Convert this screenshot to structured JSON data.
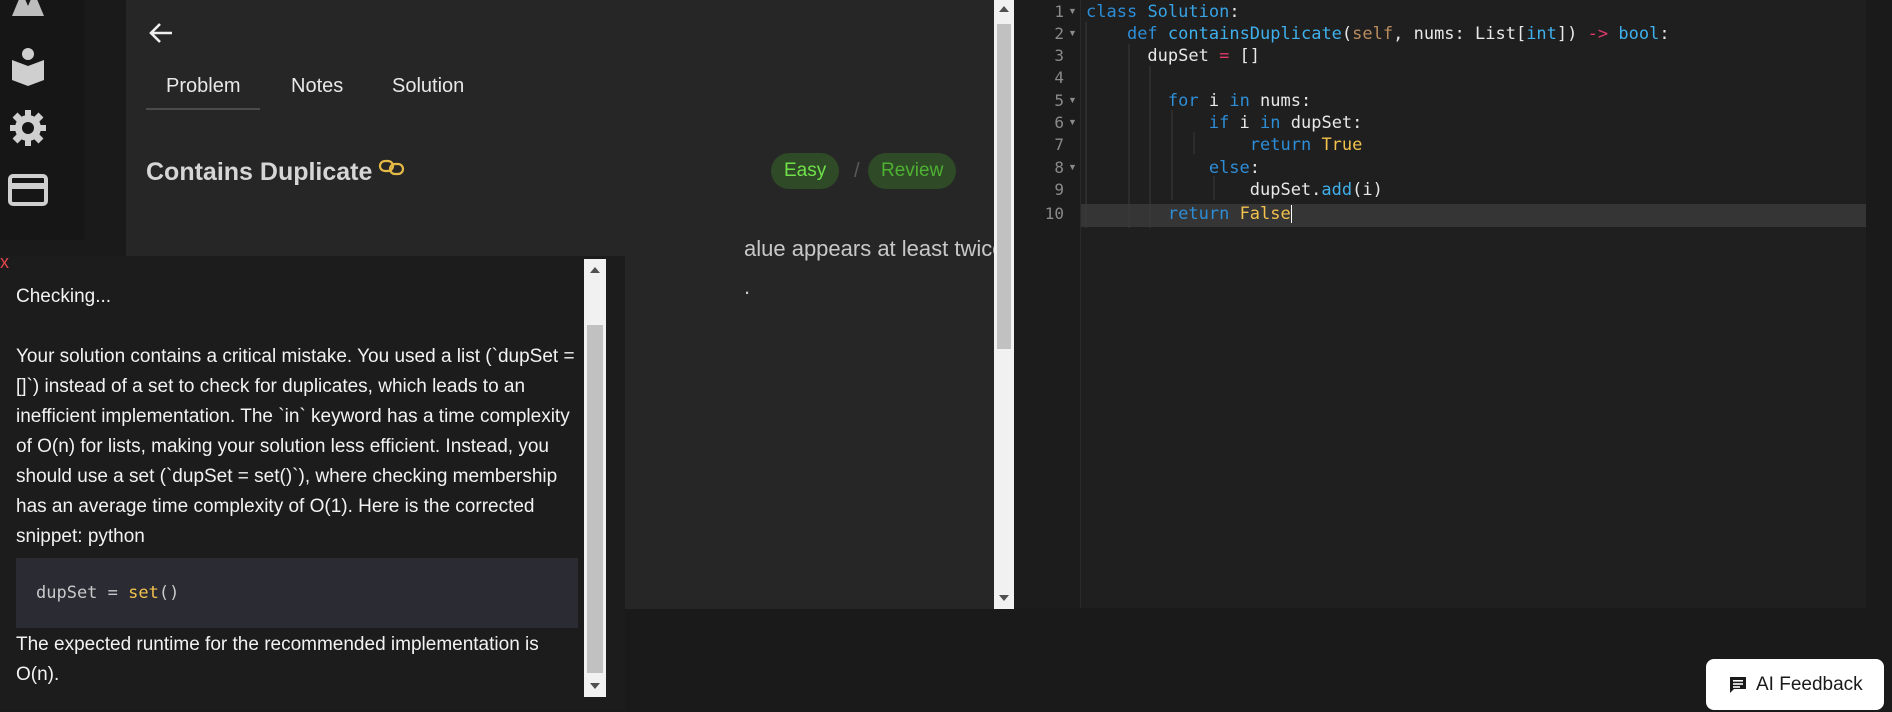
{
  "nav": {
    "icons": [
      "logo-icon",
      "book-reader-icon",
      "gear-icon",
      "card-icon"
    ]
  },
  "problem": {
    "tabs": [
      "Problem",
      "Notes",
      "Solution"
    ],
    "title": "Contains Duplicate",
    "difficulty": "Easy",
    "separator": "/",
    "review_label": "Review",
    "desc_line1": "alue appears at least twice in the",
    "desc_line2": "."
  },
  "editor": {
    "line_numbers": [
      "1",
      "2",
      "3",
      "4",
      "5",
      "6",
      "7",
      "8",
      "9",
      "10"
    ],
    "active_line": 10
  },
  "feedback": {
    "close": "x",
    "status": "Checking...",
    "body": "Your solution contains a critical mistake. You used a list (`dupSet = []`) instead of a set to check for duplicates, which leads to an inefficient implementation. The `in` keyword has a time complexity of O(n) for lists, making your solution less efficient. Instead, you should use a set (`dupSet = set()`), where checking membership has an average time complexity of O(1). Here is the corrected snippet: python",
    "code_var": "dupSet = ",
    "code_call": "set",
    "code_parens": "()",
    "conclusion": "The expected runtime for the recommended implementation is O(n)."
  },
  "ai_button": {
    "label": "AI Feedback"
  },
  "colors": {
    "easy": "#71e14a",
    "review": "#4fb132",
    "close": "#e0464b",
    "keyword": "#2d8dd6",
    "constant": "#f2c14e"
  }
}
